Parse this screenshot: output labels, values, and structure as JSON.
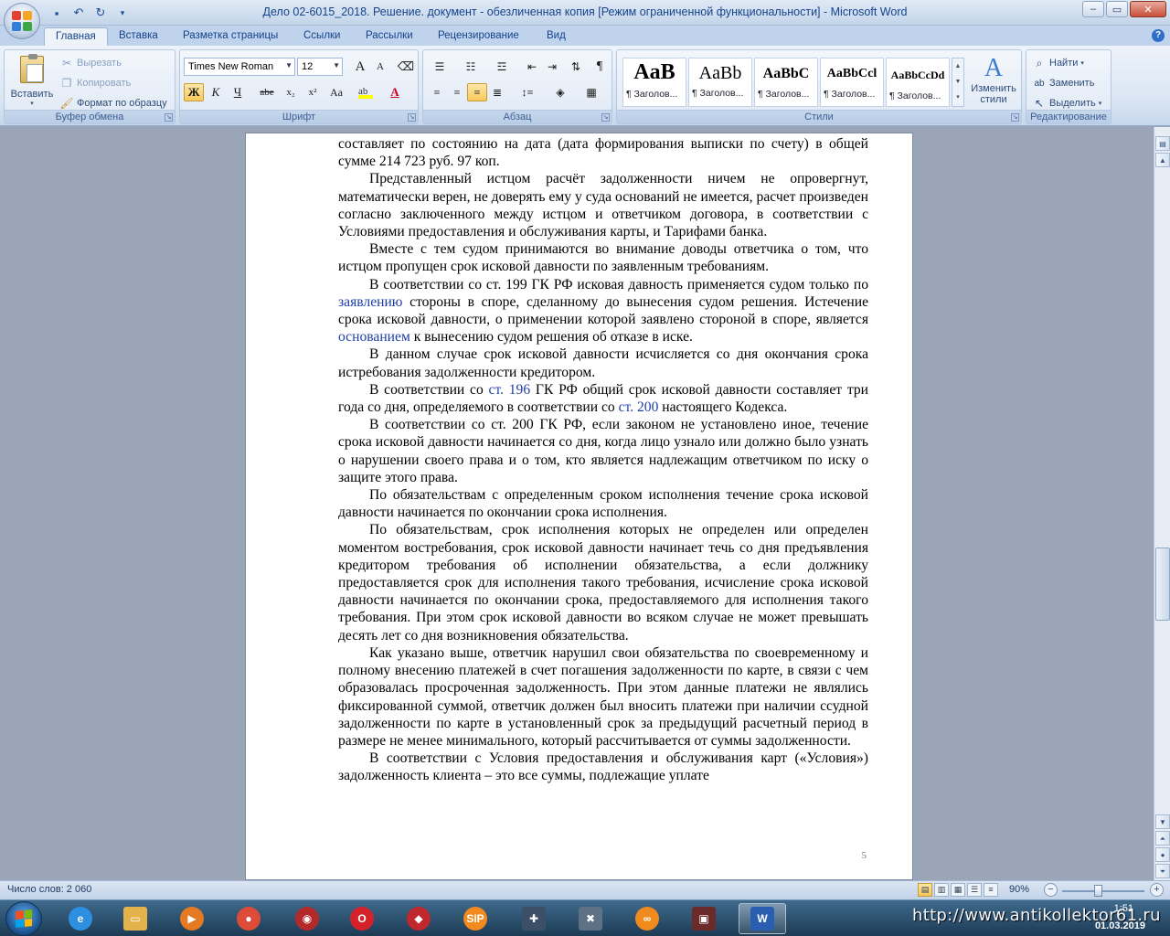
{
  "window": {
    "title": "Дело 02-6015_2018. Решение. документ - обезличенная копия [Режим ограниченной функциональности] - Microsoft Word",
    "undo_glyph": "↶",
    "redo_glyph": "↻",
    "minimize": "–",
    "maximize": "▭",
    "close": "✕"
  },
  "tabs": [
    {
      "label": "Главная",
      "active": true
    },
    {
      "label": "Вставка"
    },
    {
      "label": "Разметка страницы"
    },
    {
      "label": "Ссылки"
    },
    {
      "label": "Рассылки"
    },
    {
      "label": "Рецензирование"
    },
    {
      "label": "Вид"
    }
  ],
  "help": "?",
  "ribbon": {
    "clipboard": {
      "label": "Буфер обмена",
      "paste": "Вставить",
      "cut": "Вырезать",
      "copy": "Копировать",
      "format_painter": "Формат по образцу"
    },
    "font": {
      "label": "Шрифт",
      "font_name": "Times New Roman",
      "font_size": "12",
      "grow": "A",
      "shrink": "A",
      "bold": "Ж",
      "italic": "К",
      "underline": "Ч",
      "strike": "abe",
      "subscript": "x₂",
      "superscript": "x²",
      "case": "Aa",
      "color_a": "A"
    },
    "paragraph": {
      "label": "Абзац",
      "pilcrow": "¶"
    },
    "styles": {
      "label": "Стили",
      "tiles": [
        {
          "sample": "AaB",
          "name": "¶ Заголов..."
        },
        {
          "sample": "AaBb",
          "name": "¶ Заголов..."
        },
        {
          "sample": "AaBbC",
          "name": "¶ Заголов..."
        },
        {
          "sample": "AaBbCcl",
          "name": "¶ Заголов..."
        },
        {
          "sample": "AaBbCcDd",
          "name": "¶ Заголов..."
        }
      ],
      "change_styles_1": "Изменить",
      "change_styles_2": "стили"
    },
    "editing": {
      "label": "Редактирование",
      "find": "Найти",
      "replace": "Заменить",
      "select": "Выделить"
    }
  },
  "document": {
    "page_number": "5",
    "paragraphs": [
      {
        "cont": true,
        "parts": [
          {
            "t": "составляет по состоянию на дата (дата формирования выписки по счету) в общей сумме 214 723 руб. 97 коп."
          }
        ]
      },
      {
        "parts": [
          {
            "t": "Представленный истцом расчёт задолженности ничем не опровергнут, математически верен, не доверять ему у суда оснований не имеется, расчет произведен согласно заключенного между истцом и ответчиком договора, в соответствии с Условиями предоставления и обслуживания карты, и Тарифами банка."
          }
        ]
      },
      {
        "parts": [
          {
            "t": "Вместе с тем судом принимаются во внимание доводы ответчика о том, что истцом пропущен срок исковой давности по заявленным требованиям."
          }
        ]
      },
      {
        "parts": [
          {
            "t": "В соответствии со ст. 199 ГК РФ исковая давность применяется судом только по "
          },
          {
            "t": "заявлению",
            "link": true
          },
          {
            "t": " стороны в споре, сделанному до вынесения судом решения. Истечение срока исковой давности, о применении которой заявлено стороной в споре, является "
          },
          {
            "t": "основанием",
            "link": true
          },
          {
            "t": " к вынесению судом решения об отказе в иске."
          }
        ]
      },
      {
        "parts": [
          {
            "t": "В данном случае срок исковой давности исчисляется со дня окончания срока истребования задолженности кредитором."
          }
        ]
      },
      {
        "parts": [
          {
            "t": "В соответствии со "
          },
          {
            "t": "ст. 196",
            "link": true
          },
          {
            "t": " ГК РФ общий срок исковой давности составляет три года со дня, определяемого в соответствии со "
          },
          {
            "t": "ст. 200",
            "link": true
          },
          {
            "t": " настоящего Кодекса."
          }
        ]
      },
      {
        "parts": [
          {
            "t": "В соответствии со ст. 200 ГК РФ, если законом не установлено иное, течение срока исковой давности начинается со дня, когда лицо узнало или должно было узнать о нарушении своего права и о том, кто является надлежащим ответчиком по иску о защите этого права."
          }
        ]
      },
      {
        "parts": [
          {
            "t": "По обязательствам с определенным сроком исполнения течение срока исковой давности начинается по окончании срока исполнения."
          }
        ]
      },
      {
        "parts": [
          {
            "t": "По обязательствам, срок исполнения которых не определен или определен моментом востребования, срок исковой давности начинает течь со дня предъявления кредитором требования об исполнении обязательства, а если должнику предоставляется срок для исполнения такого требования, исчисление срока исковой давности начинается по окончании срока, предоставляемого для исполнения такого требования. При этом срок исковой давности во всяком случае не может превышать десять лет со дня возникновения обязательства."
          }
        ]
      },
      {
        "parts": [
          {
            "t": "Как указано выше, ответчик нарушил свои обязательства по своевременному и полному внесению платежей в счет погашения задолженности по карте, в связи с чем образовалась просроченная задолженность. При этом данные платежи не являлись фиксированной суммой, ответчик должен был вносить платежи при наличии ссудной задолженности по карте в установленный срок за предыдущий расчетный период в размере не менее минимального, который рассчитывается от суммы задолженности."
          }
        ]
      },
      {
        "parts": [
          {
            "t": "В соответствии с Условия предоставления и обслуживания карт («Условия») задолженность клиента – это все суммы, подлежащие уплате"
          }
        ]
      }
    ]
  },
  "status": {
    "word_count": "Число слов: 2 060",
    "zoom": "90%",
    "zoom_minus": "−",
    "zoom_plus": "+"
  },
  "taskbar": {
    "watermark": "http://www.antikollektor61.ru",
    "clock_time": "1:51",
    "clock_date": "01.03.2019",
    "apps": [
      {
        "name": "internet-explorer",
        "glyph": "e",
        "color": "#2c8fe0"
      },
      {
        "name": "file-explorer",
        "glyph": "▭",
        "color": "#e3b24a"
      },
      {
        "name": "media-player",
        "glyph": "▶",
        "color": "#e57a22"
      },
      {
        "name": "chrome",
        "glyph": "●",
        "color": "#dd4b39"
      },
      {
        "name": "app-red-swirl",
        "glyph": "◉",
        "color": "#b42a2a"
      },
      {
        "name": "opera",
        "glyph": "O",
        "color": "#d5222a"
      },
      {
        "name": "app-red-cube",
        "glyph": "◆",
        "color": "#c0282d"
      },
      {
        "name": "sip-phone",
        "glyph": "SIP",
        "color": "#f28a1e"
      },
      {
        "name": "app-arrows",
        "glyph": "✚",
        "color": "#3b4f66"
      },
      {
        "name": "app-tools",
        "glyph": "✖",
        "color": "#5f7184"
      },
      {
        "name": "app-orange-link",
        "glyph": "∞",
        "color": "#f08a1c"
      },
      {
        "name": "app-film",
        "glyph": "▣",
        "color": "#6b2b2b"
      },
      {
        "name": "word",
        "glyph": "W",
        "color": "#2a5eb0",
        "active": true
      }
    ]
  }
}
